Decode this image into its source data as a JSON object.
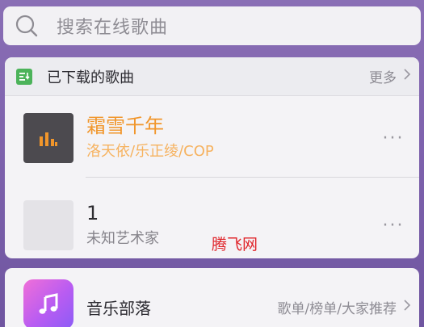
{
  "search": {
    "placeholder": "搜索在线歌曲",
    "icon": "search-icon"
  },
  "downloaded": {
    "title": "已下载的歌曲",
    "more_label": "更多",
    "icon": "download-list-icon",
    "accent_color": "#4cb35a",
    "songs": [
      {
        "title": "霜雪千年",
        "artist": "洛天依/乐正绫/COP",
        "cover_icon": "now-playing-bars-icon",
        "playing": true,
        "color": "#f1962b"
      },
      {
        "title": "1",
        "artist": "未知艺术家",
        "cover_icon": "blank-cover",
        "playing": false
      }
    ]
  },
  "watermark": {
    "text": "腾飞网",
    "color": "#e0252b"
  },
  "tribe": {
    "title": "音乐部落",
    "subtitle": "歌单/榜单/大家推荐",
    "icon": "music-note-icon"
  }
}
